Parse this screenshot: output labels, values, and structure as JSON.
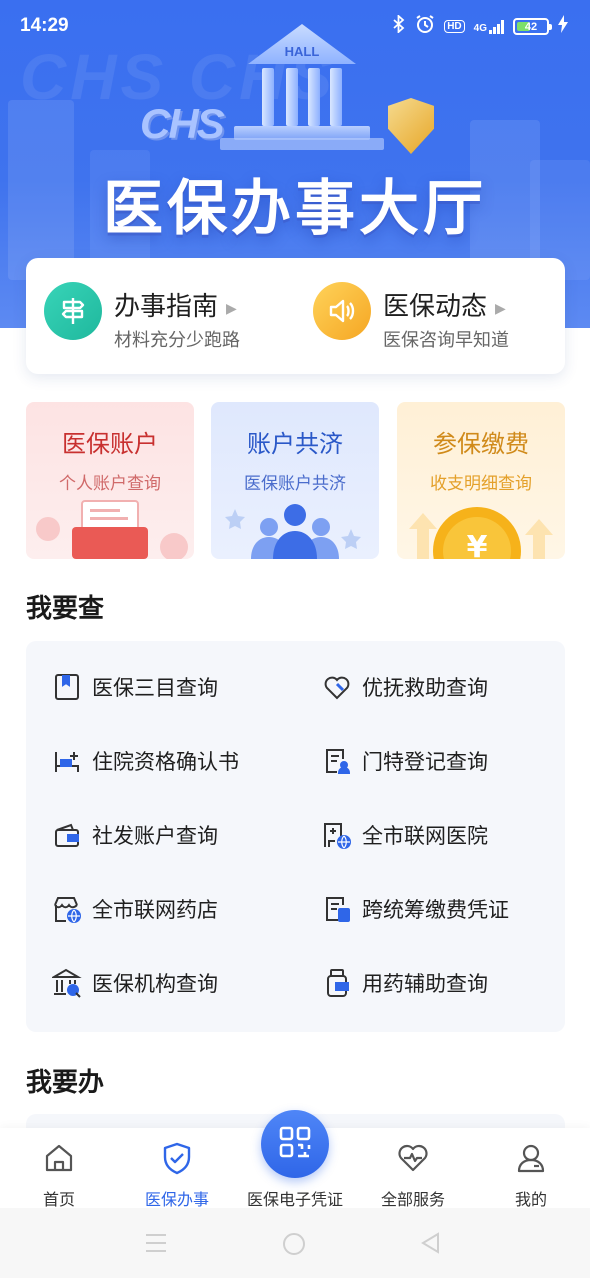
{
  "status": {
    "time": "14:29",
    "network": "4G",
    "hd": "HD",
    "battery": "42"
  },
  "hero": {
    "title": "医保办事大厅",
    "hall_label": "HALL",
    "logo_text": "CHS"
  },
  "quick": [
    {
      "title": "办事指南",
      "subtitle": "材料充分少跑路",
      "icon": "signpost-icon"
    },
    {
      "title": "医保动态",
      "subtitle": "医保咨询早知道",
      "icon": "speaker-icon"
    }
  ],
  "features": [
    {
      "title": "医保账户",
      "subtitle": "个人账户查询"
    },
    {
      "title": "账户共济",
      "subtitle": "医保账户共济"
    },
    {
      "title": "参保缴费",
      "subtitle": "收支明细查询"
    }
  ],
  "query_section": {
    "title": "我要查",
    "items": [
      {
        "label": "医保三目查询",
        "icon": "bookmark-doc-icon"
      },
      {
        "label": "优抚救助查询",
        "icon": "heart-hand-icon"
      },
      {
        "label": "住院资格确认书",
        "icon": "hospital-bed-icon"
      },
      {
        "label": "门特登记查询",
        "icon": "register-doc-icon"
      },
      {
        "label": "社发账户查询",
        "icon": "wallet-icon"
      },
      {
        "label": "全市联网医院",
        "icon": "hospital-network-icon"
      },
      {
        "label": "全市联网药店",
        "icon": "pharmacy-network-icon"
      },
      {
        "label": "跨统筹缴费凭证",
        "icon": "payment-voucher-icon"
      },
      {
        "label": "医保机构查询",
        "icon": "institution-search-icon"
      },
      {
        "label": "用药辅助查询",
        "icon": "medicine-bottle-icon"
      }
    ]
  },
  "do_section": {
    "title": "我要办"
  },
  "tabbar": {
    "tabs": [
      {
        "label": "首页",
        "icon": "home-icon"
      },
      {
        "label": "医保办事",
        "icon": "shield-check-icon"
      },
      {
        "label": "医保电子凭证",
        "icon": "qr-code-icon"
      },
      {
        "label": "全部服务",
        "icon": "heart-pulse-icon"
      },
      {
        "label": "我的",
        "icon": "user-icon"
      }
    ],
    "active_index": 1
  },
  "colors": {
    "primary": "#2f66e8",
    "hero": "#3f73ee",
    "teal": "#1fb89d",
    "gold": "#f5a623",
    "red": "#c8302f"
  }
}
